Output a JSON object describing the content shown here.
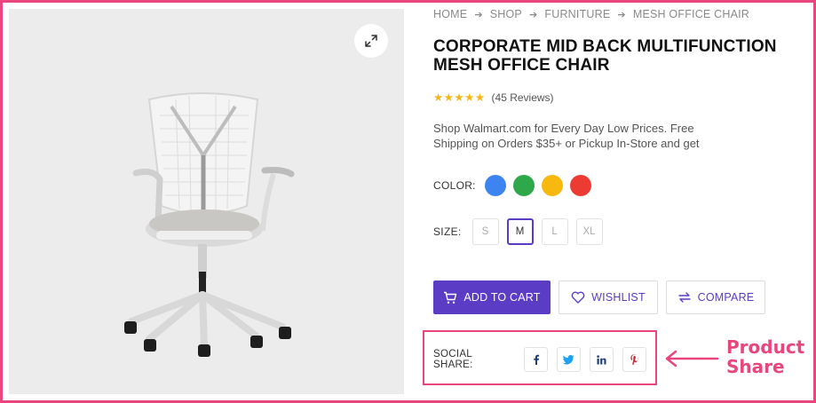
{
  "breadcrumb": [
    "HOME",
    "SHOP",
    "FURNITURE",
    "MESH OFFICE CHAIR"
  ],
  "product": {
    "title": "CORPORATE MID BACK MULTIFUNCTION MESH OFFICE CHAIR",
    "rating_stars": "★★★★★",
    "rating_value": 5,
    "reviews": "(45 Reviews)",
    "description": "Shop Walmart.com for Every Day Low Prices. Free Shipping on Orders $35+ or Pickup In-Store and get"
  },
  "color": {
    "label": "COLOR:",
    "swatches": [
      "#3d84f0",
      "#2ea84a",
      "#f7b90f",
      "#eb3b32"
    ]
  },
  "size": {
    "label": "SIZE:",
    "options": [
      "S",
      "M",
      "L",
      "XL"
    ],
    "selected": "M"
  },
  "actions": {
    "add_to_cart": "ADD TO CART",
    "wishlist": "WISHLIST",
    "compare": "COMPARE"
  },
  "share": {
    "label": "SOCIAL SHARE:",
    "icons": [
      "facebook-icon",
      "twitter-icon",
      "linkedin-icon",
      "pinterest-icon"
    ]
  },
  "annotation": {
    "line1": "Product",
    "line2": "Share"
  },
  "colors": {
    "accent": "#5b3cc4",
    "highlight": "#e8467c",
    "star": "#f5b614"
  }
}
